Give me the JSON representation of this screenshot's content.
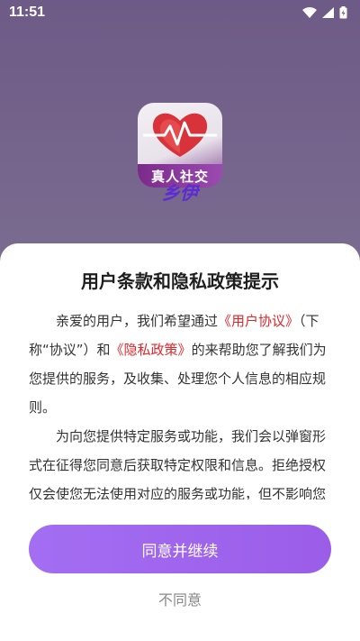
{
  "status_bar": {
    "time": "11:51"
  },
  "app": {
    "logo_text": "真人社交",
    "name": "乡伊"
  },
  "dialog": {
    "title": "用户条款和隐私政策提示",
    "p1_a": "亲爱的用户，我们希望通过",
    "p1_link1": "《用户协议》",
    "p1_b": "（下称“协议”）和",
    "p1_link2": "《隐私政策》",
    "p1_c": "的来帮助您了解我们为您提供的服务，及收集、处理您个人信息的相应规则。",
    "p2": "为向您提供特定服务或功能，我们会以弹窗形式在征得您同意后获取特定权限和信息。拒绝授权仅会使您无法使用对应的服务或功能，但不影响您使用其他服务。",
    "agree_label": "同意并继续",
    "disagree_label": "不同意"
  },
  "colors": {
    "accent": "#9b5de8",
    "link": "#e2262a",
    "app_name": "#5e2ad6"
  }
}
